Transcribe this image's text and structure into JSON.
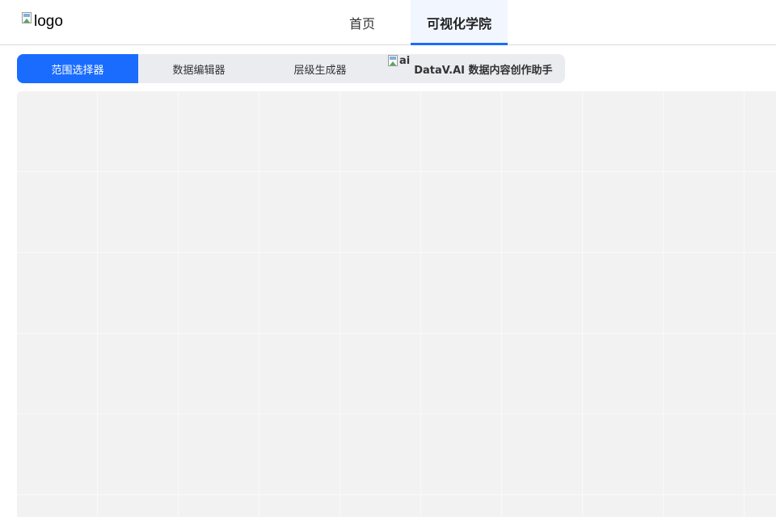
{
  "header": {
    "logo_alt": "logo",
    "nav": {
      "home_label": "首页",
      "academy_label": "可视化学院"
    }
  },
  "tools": {
    "tabs": [
      {
        "label": "范围选择器",
        "active": true
      },
      {
        "label": "数据编辑器",
        "active": false
      },
      {
        "label": "层级生成器",
        "active": false
      },
      {
        "label": "DataV.AI 数据内容创作助手",
        "icon_alt": "ai",
        "active": false
      }
    ]
  },
  "colors": {
    "accent": "#1a6cff",
    "tab_bar_bg": "#eaecf0",
    "canvas_bg": "#f2f2f2"
  }
}
